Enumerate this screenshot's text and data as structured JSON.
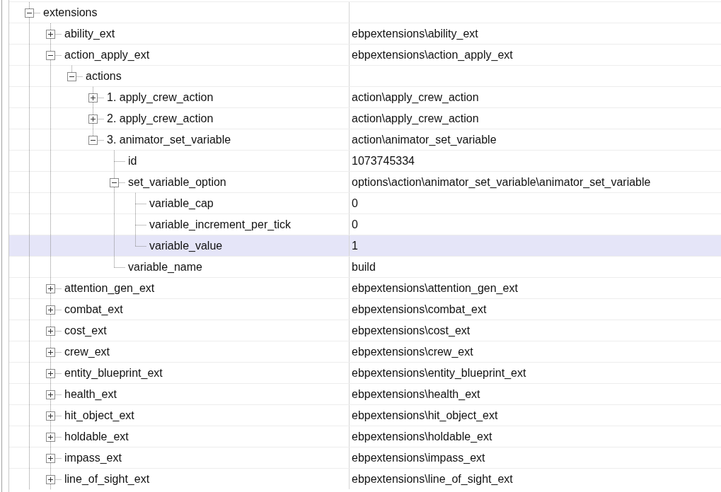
{
  "tree": [
    {
      "name": "extensions",
      "expanded": true,
      "selected": false,
      "children": [
        {
          "name": "ability_ext",
          "value": "ebpextensions\\ability_ext",
          "expanded": false,
          "selected": false
        },
        {
          "name": "action_apply_ext",
          "value": "ebpextensions\\action_apply_ext",
          "expanded": true,
          "selected": false,
          "children": [
            {
              "name": "actions",
              "expanded": true,
              "selected": false,
              "children": [
                {
                  "name": "1. apply_crew_action",
                  "value": "action\\apply_crew_action",
                  "expanded": false,
                  "selected": false
                },
                {
                  "name": "2. apply_crew_action",
                  "value": "action\\apply_crew_action",
                  "expanded": false,
                  "selected": false
                },
                {
                  "name": "3. animator_set_variable",
                  "value": "action\\animator_set_variable",
                  "expanded": true,
                  "selected": false,
                  "children": [
                    {
                      "name": "id",
                      "value": "1073745334",
                      "selected": false
                    },
                    {
                      "name": "set_variable_option",
                      "value": "options\\action\\animator_set_variable\\animator_set_variable",
                      "expanded": true,
                      "selected": false,
                      "children": [
                        {
                          "name": "variable_cap",
                          "value": "0",
                          "selected": false
                        },
                        {
                          "name": "variable_increment_per_tick",
                          "value": "0",
                          "selected": false
                        },
                        {
                          "name": "variable_value",
                          "value": "1",
                          "selected": true
                        }
                      ]
                    },
                    {
                      "name": "variable_name",
                      "value": "build",
                      "selected": false
                    }
                  ]
                }
              ]
            }
          ]
        },
        {
          "name": "attention_gen_ext",
          "value": "ebpextensions\\attention_gen_ext",
          "expanded": false,
          "selected": false
        },
        {
          "name": "combat_ext",
          "value": "ebpextensions\\combat_ext",
          "expanded": false,
          "selected": false
        },
        {
          "name": "cost_ext",
          "value": "ebpextensions\\cost_ext",
          "expanded": false,
          "selected": false
        },
        {
          "name": "crew_ext",
          "value": "ebpextensions\\crew_ext",
          "expanded": false,
          "selected": false
        },
        {
          "name": "entity_blueprint_ext",
          "value": "ebpextensions\\entity_blueprint_ext",
          "expanded": false,
          "selected": false
        },
        {
          "name": "health_ext",
          "value": "ebpextensions\\health_ext",
          "expanded": false,
          "selected": false
        },
        {
          "name": "hit_object_ext",
          "value": "ebpextensions\\hit_object_ext",
          "expanded": false,
          "selected": false
        },
        {
          "name": "holdable_ext",
          "value": "ebpextensions\\holdable_ext",
          "expanded": false,
          "selected": false
        },
        {
          "name": "impass_ext",
          "value": "ebpextensions\\impass_ext",
          "expanded": false,
          "selected": false
        },
        {
          "name": "line_of_sight_ext",
          "value": "ebpextensions\\line_of_sight_ext",
          "expanded": false,
          "selected": false
        }
      ]
    }
  ]
}
